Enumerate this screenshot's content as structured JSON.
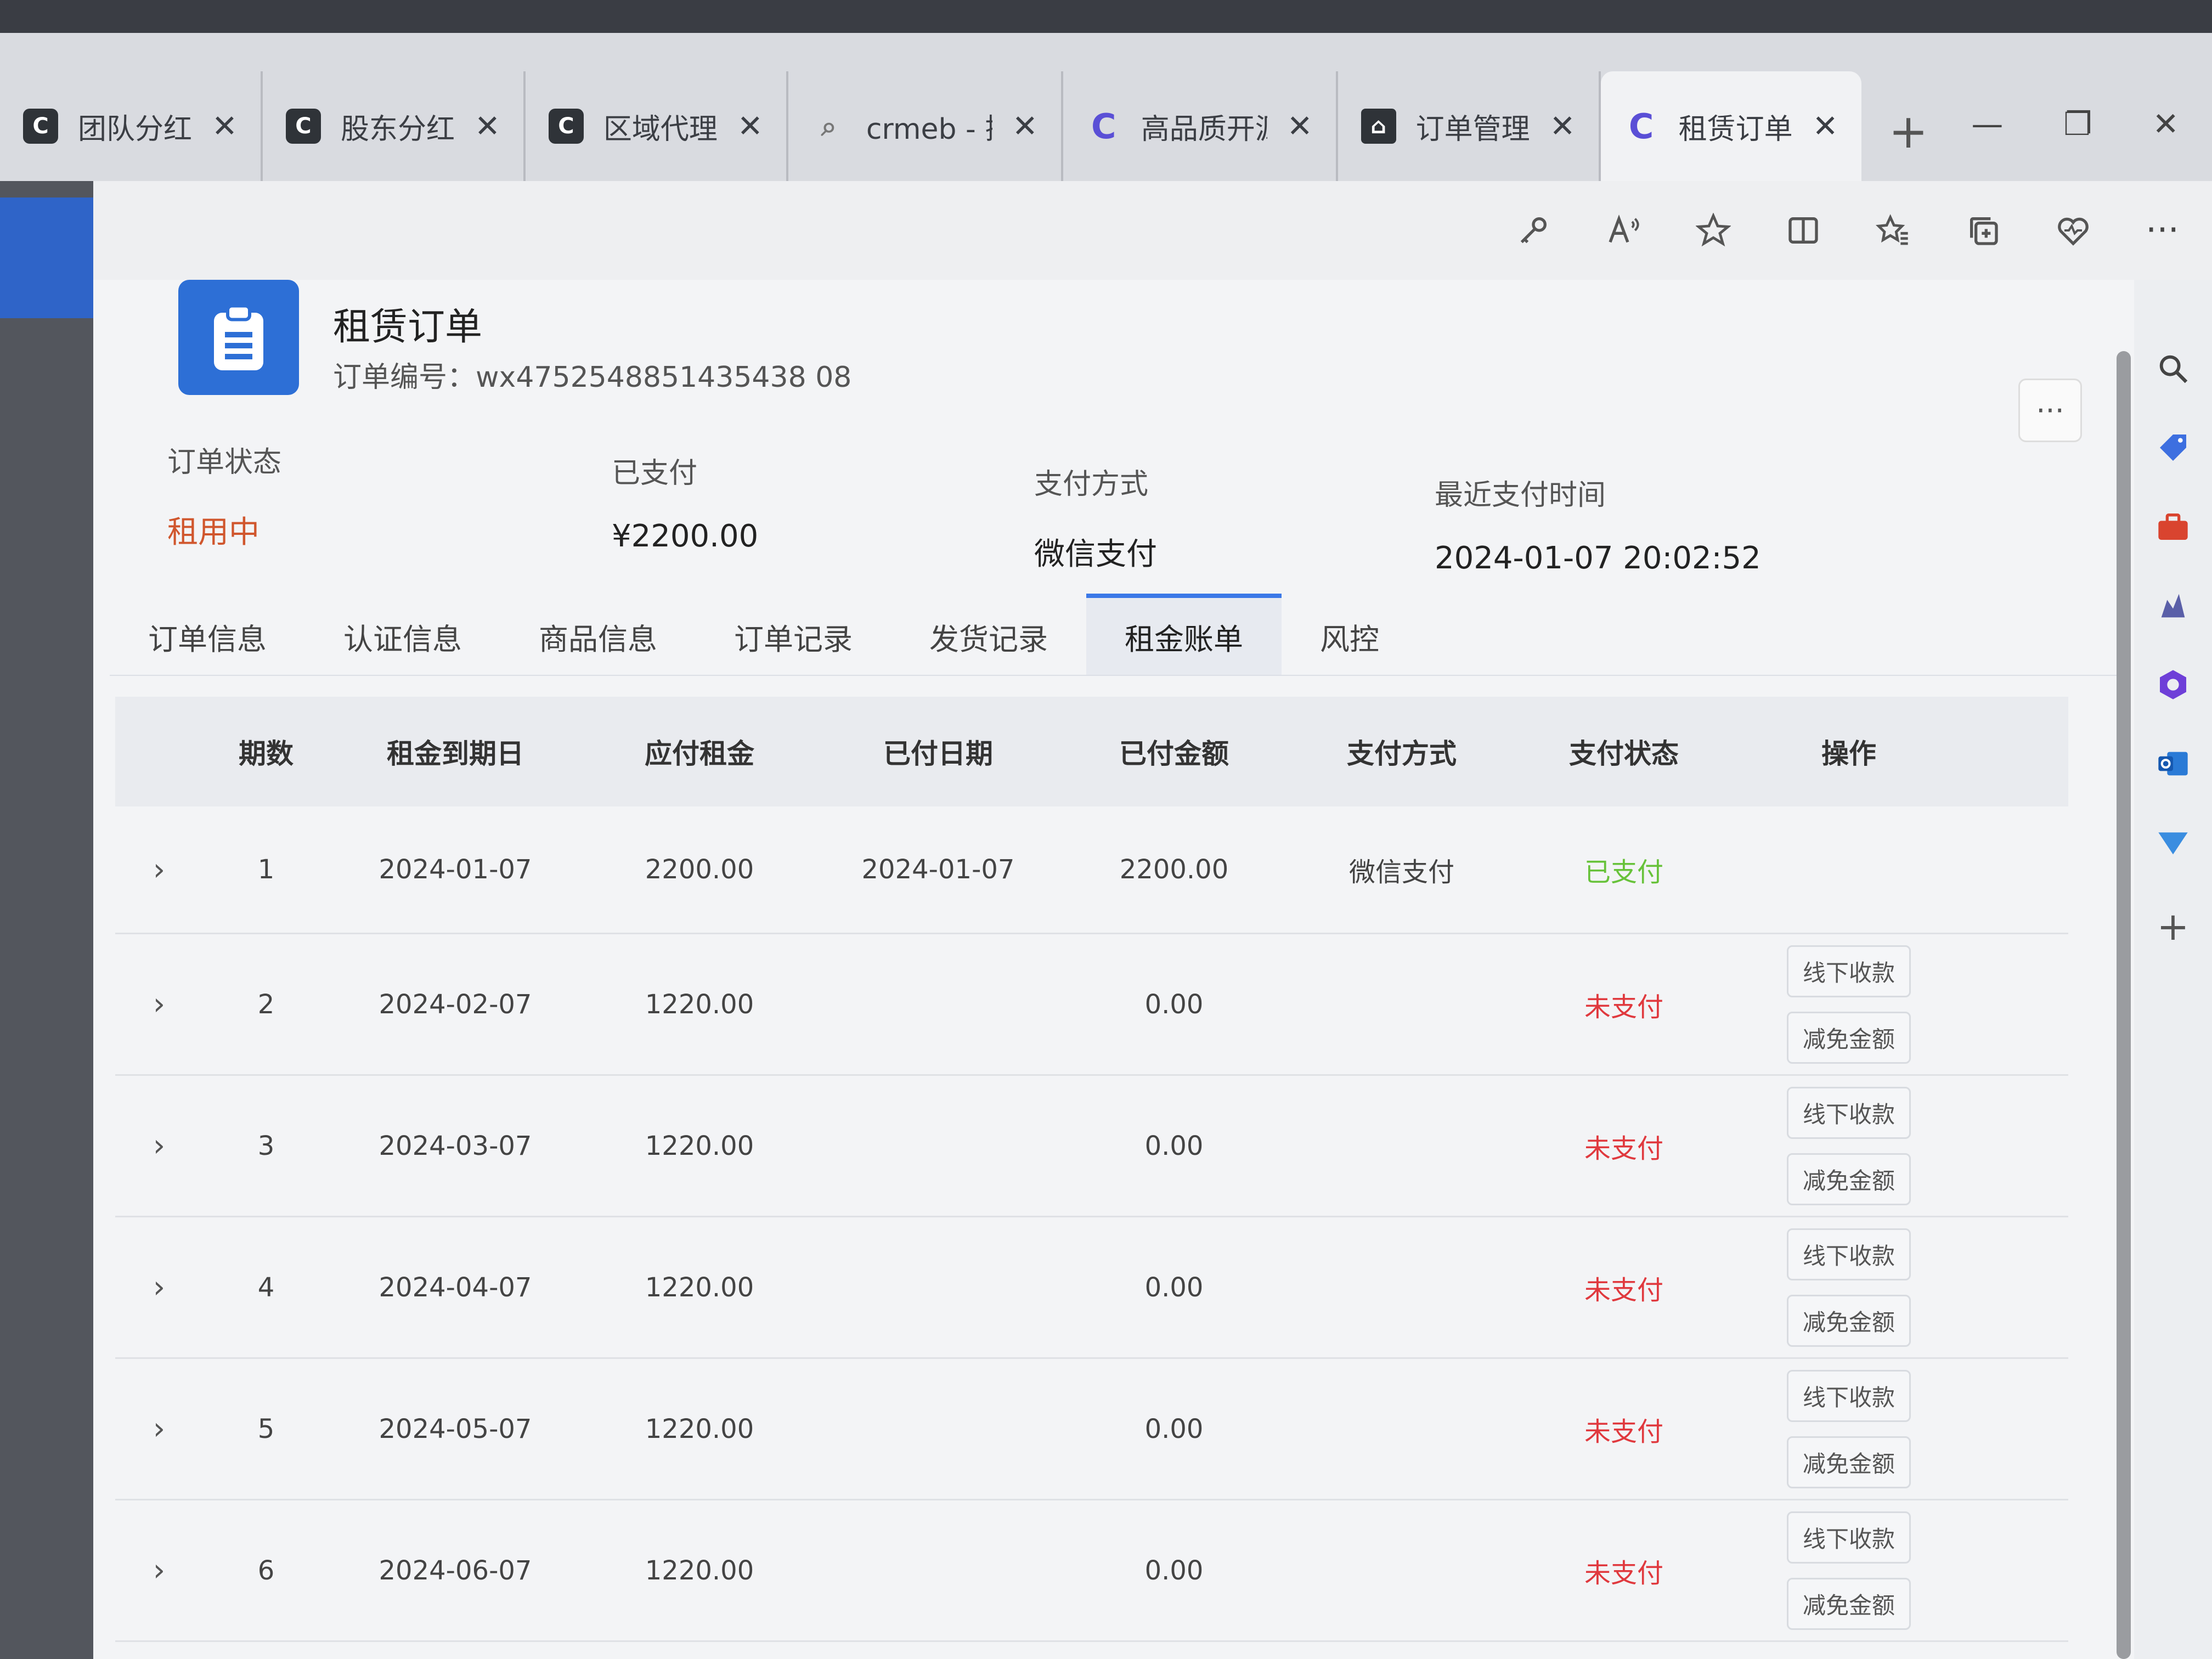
{
  "browser": {
    "tabs": [
      {
        "icon": "crmeb-icon",
        "label": "团队分红"
      },
      {
        "icon": "crmeb-icon",
        "label": "股东分红"
      },
      {
        "icon": "crmeb-icon",
        "label": "区域代理"
      },
      {
        "icon": "search-icon",
        "label": "crmeb - 搜"
      },
      {
        "icon": "c-icon",
        "label": "高品质开源"
      },
      {
        "icon": "admin-icon",
        "label": "订单管理"
      },
      {
        "icon": "c-icon",
        "label": "租赁订单"
      }
    ],
    "new_tab": "+",
    "window_controls": [
      "—",
      "❐",
      "✕"
    ]
  },
  "header": {
    "title": "租赁订单",
    "order_no_label": "订单编号：",
    "order_no": "wx4752548851435438 08",
    "more": "···"
  },
  "summary": {
    "status_label": "订单状态",
    "status_value": "租用中",
    "paid_label": "已支付",
    "paid_value": "¥2200.00",
    "method_label": "支付方式",
    "method_value": "微信支付",
    "last_pay_label": "最近支付时间",
    "last_pay_value": "2024-01-07 20:02:52"
  },
  "tabs": [
    "订单信息",
    "认证信息",
    "商品信息",
    "订单记录",
    "发货记录",
    "租金账单",
    "风控"
  ],
  "active_tab": "租金账单",
  "table": {
    "headers": {
      "period": "期数",
      "due": "租金到期日",
      "amount": "应付租金",
      "paid_date": "已付日期",
      "paid_amount": "已付金额",
      "method": "支付方式",
      "status": "支付状态",
      "op": "操作"
    },
    "rows": [
      {
        "period": "1",
        "due": "2024-01-07",
        "amount": "2200.00",
        "paid_date": "2024-01-07",
        "paid_amount": "2200.00",
        "method": "微信支付",
        "status": "已支付"
      },
      {
        "period": "2",
        "due": "2024-02-07",
        "amount": "1220.00",
        "paid_date": "",
        "paid_amount": "0.00",
        "method": "",
        "status": "未支付"
      },
      {
        "period": "3",
        "due": "2024-03-07",
        "amount": "1220.00",
        "paid_date": "",
        "paid_amount": "0.00",
        "method": "",
        "status": "未支付"
      },
      {
        "period": "4",
        "due": "2024-04-07",
        "amount": "1220.00",
        "paid_date": "",
        "paid_amount": "0.00",
        "method": "",
        "status": "未支付"
      },
      {
        "period": "5",
        "due": "2024-05-07",
        "amount": "1220.00",
        "paid_date": "",
        "paid_amount": "0.00",
        "method": "",
        "status": "未支付"
      },
      {
        "period": "6",
        "due": "2024-06-07",
        "amount": "1220.00",
        "paid_date": "",
        "paid_amount": "0.00",
        "method": "",
        "status": "未支付"
      }
    ],
    "op_offline": "线下收款",
    "op_discount": "减免金额",
    "expand_glyph": "›"
  },
  "colors": {
    "accent": "#3b78e7",
    "paid": "#67c23a",
    "unpaid": "#e0393e",
    "status": "#d0562d"
  }
}
